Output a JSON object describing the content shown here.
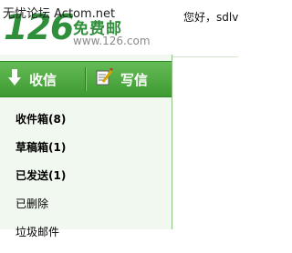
{
  "watermark": "无忧论坛 Actom.net",
  "logo": {
    "digits": "126",
    "tagline": "免费邮",
    "url": "www.126.com"
  },
  "greeting": "您好，sdlv",
  "toolbar": {
    "receive_label": "收信",
    "compose_label": "写信"
  },
  "folders": [
    {
      "label": "收件箱(8)",
      "bold": true
    },
    {
      "label": "草稿箱(1)",
      "bold": true
    },
    {
      "label": "已发送(1)",
      "bold": true
    },
    {
      "label": "已删除",
      "bold": false
    },
    {
      "label": "垃圾邮件",
      "bold": false
    }
  ],
  "colors": {
    "brand_green": "#2f8f3b",
    "tab_green": "#4caa40",
    "panel_bg": "#f1f8ef"
  }
}
